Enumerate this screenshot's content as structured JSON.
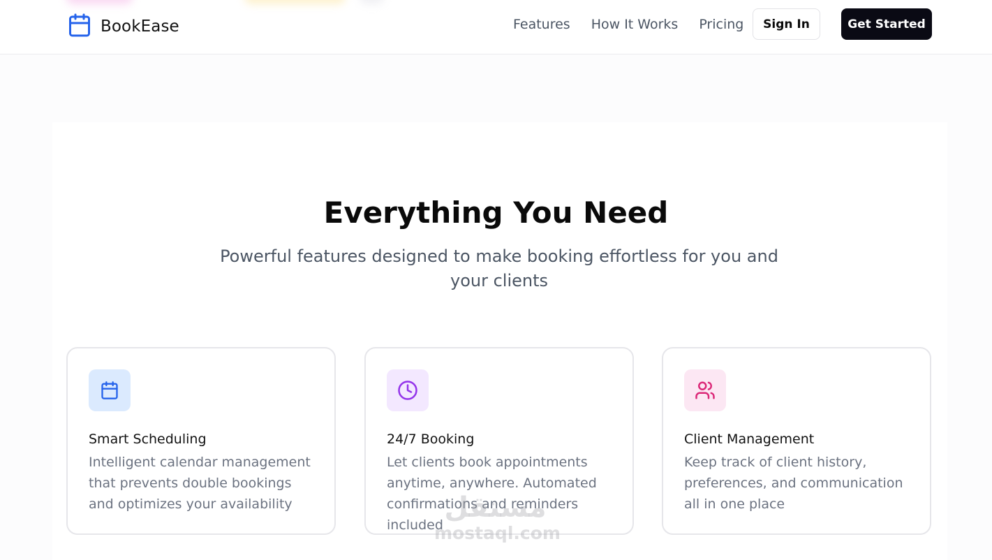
{
  "brand": {
    "name": "BookEase",
    "icon": "calendar-icon",
    "accent": "#2563eb"
  },
  "nav": {
    "items": [
      "Features",
      "How It Works",
      "Pricing"
    ]
  },
  "actions": {
    "sign_in": "Sign In",
    "get_started": "Get Started"
  },
  "features_section": {
    "title": "Everything You Need",
    "subtitle": "Powerful features designed to make booking effortless for you and your clients",
    "cards": [
      {
        "icon": "calendar-icon",
        "icon_color": "#2563eb",
        "icon_bg": "#dbeafe",
        "title": "Smart Scheduling",
        "description": "Intelligent calendar management that prevents double bookings and optimizes your availability"
      },
      {
        "icon": "clock-icon",
        "icon_color": "#9333ea",
        "icon_bg": "#f3e8ff",
        "title": "24/7 Booking",
        "description": "Let clients book appointments anytime, anywhere. Automated confirmations and reminders included"
      },
      {
        "icon": "users-icon",
        "icon_color": "#db2777",
        "icon_bg": "#fce7f3",
        "title": "Client Management",
        "description": "Keep track of client history, preferences, and communication all in one place"
      }
    ]
  },
  "watermark": {
    "arabic": "مستقل",
    "latin": "mostaql.com"
  }
}
